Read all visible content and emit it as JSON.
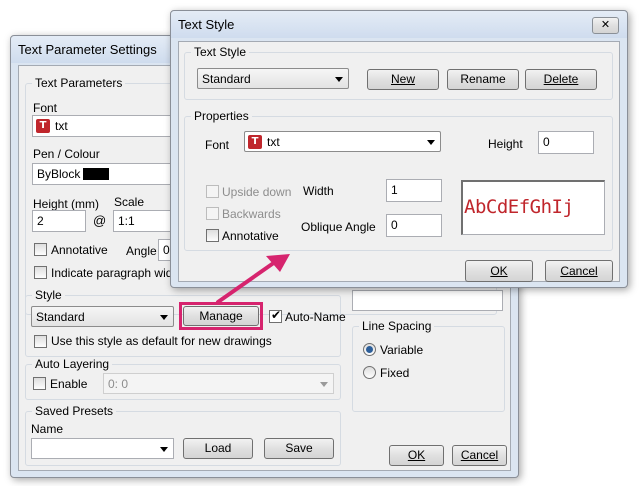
{
  "text_parameter_settings": {
    "title": "Text Parameter Settings",
    "text_parameters": {
      "group_title": "Text Parameters",
      "font_label": "Font",
      "font_value": "txt",
      "pen_label": "Pen / Colour",
      "pen_value": "ByBlock",
      "height_label": "Height (mm)",
      "height_value": "2",
      "at_symbol": "@",
      "scale_label": "Scale",
      "scale_value": "1:1",
      "annotative_label": "Annotative",
      "angle_label": "Angle",
      "angle_value": "0",
      "indicate_label": "Indicate paragraph width"
    },
    "style": {
      "group_title": "Style",
      "value": "Standard",
      "manage_label": "Manage",
      "auto_name_label": "Auto-Name",
      "use_default_label": "Use this style as default for new drawings"
    },
    "auto_layering": {
      "group_title": "Auto Layering",
      "enable_label": "Enable",
      "layer_value": "0: 0"
    },
    "saved_presets": {
      "group_title": "Saved Presets",
      "name_label": "Name",
      "name_value": "",
      "load_label": "Load",
      "save_label": "Save"
    },
    "line_spacing": {
      "group_title": "Line Spacing",
      "variable_label": "Variable",
      "fixed_label": "Fixed",
      "selected": "Variable"
    },
    "ok_label": "OK",
    "cancel_label": "Cancel"
  },
  "text_style_dialog": {
    "title": "Text Style",
    "close_label": "✕",
    "text_style": {
      "group_title": "Text Style",
      "value": "Standard",
      "new_label": "New",
      "rename_label": "Rename",
      "delete_label": "Delete"
    },
    "properties": {
      "group_title": "Properties",
      "font_label": "Font",
      "font_value": "txt",
      "height_label": "Height",
      "height_value": "0",
      "upside_down_label": "Upside down",
      "backwards_label": "Backwards",
      "annotative_label": "Annotative",
      "width_label": "Width",
      "width_value": "1",
      "oblique_label": "Oblique Angle",
      "oblique_value": "0",
      "preview_text": "AbCdEfGhIj"
    },
    "ok_label": "OK",
    "cancel_label": "Cancel"
  },
  "colors": {
    "highlight": "#d6246e",
    "preview_text": "#c0262c",
    "title_gradient_top": "#dfe8f4",
    "title_gradient_bottom": "#c7d6ea"
  },
  "icons": {
    "font_icon": "truetype-font-icon",
    "pen_swatch": "black-color-swatch",
    "annotation_arrow": "pink-arrow"
  }
}
